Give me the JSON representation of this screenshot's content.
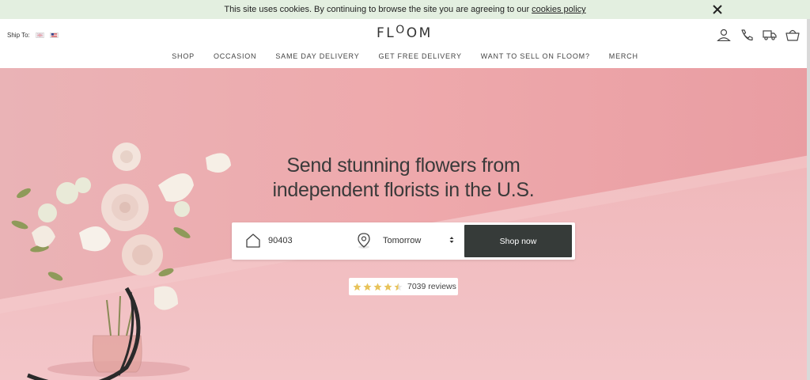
{
  "cookie_bar": {
    "text": "This site uses cookies. By continuing to browse the site you are agreeing to our",
    "link": "cookies policy"
  },
  "header": {
    "ship_to_label": "Ship To:",
    "logo": {
      "part1": "FL",
      "part2": "O",
      "part3": "O",
      "part4": "M"
    },
    "icons": [
      "account-icon",
      "phone-icon",
      "delivery-truck-icon",
      "basket-icon"
    ],
    "nav": [
      "SHOP",
      "OCCASION",
      "SAME DAY DELIVERY",
      "GET FREE DELIVERY",
      "WANT TO SELL ON FLOOM?",
      "MERCH"
    ]
  },
  "hero": {
    "headline_line1": "Send stunning flowers from",
    "headline_line2": "independent florists in the U.S.",
    "zip_value": "90403",
    "date_value": "Tomorrow",
    "shop_button": "Shop now",
    "reviews": "7039 reviews",
    "rating": 4.5
  },
  "colors": {
    "cookie_bg": "#e3efe0",
    "hero_pink": "#eda8ab",
    "button_dark": "#363b39",
    "star_gold": "#e8c35a"
  }
}
